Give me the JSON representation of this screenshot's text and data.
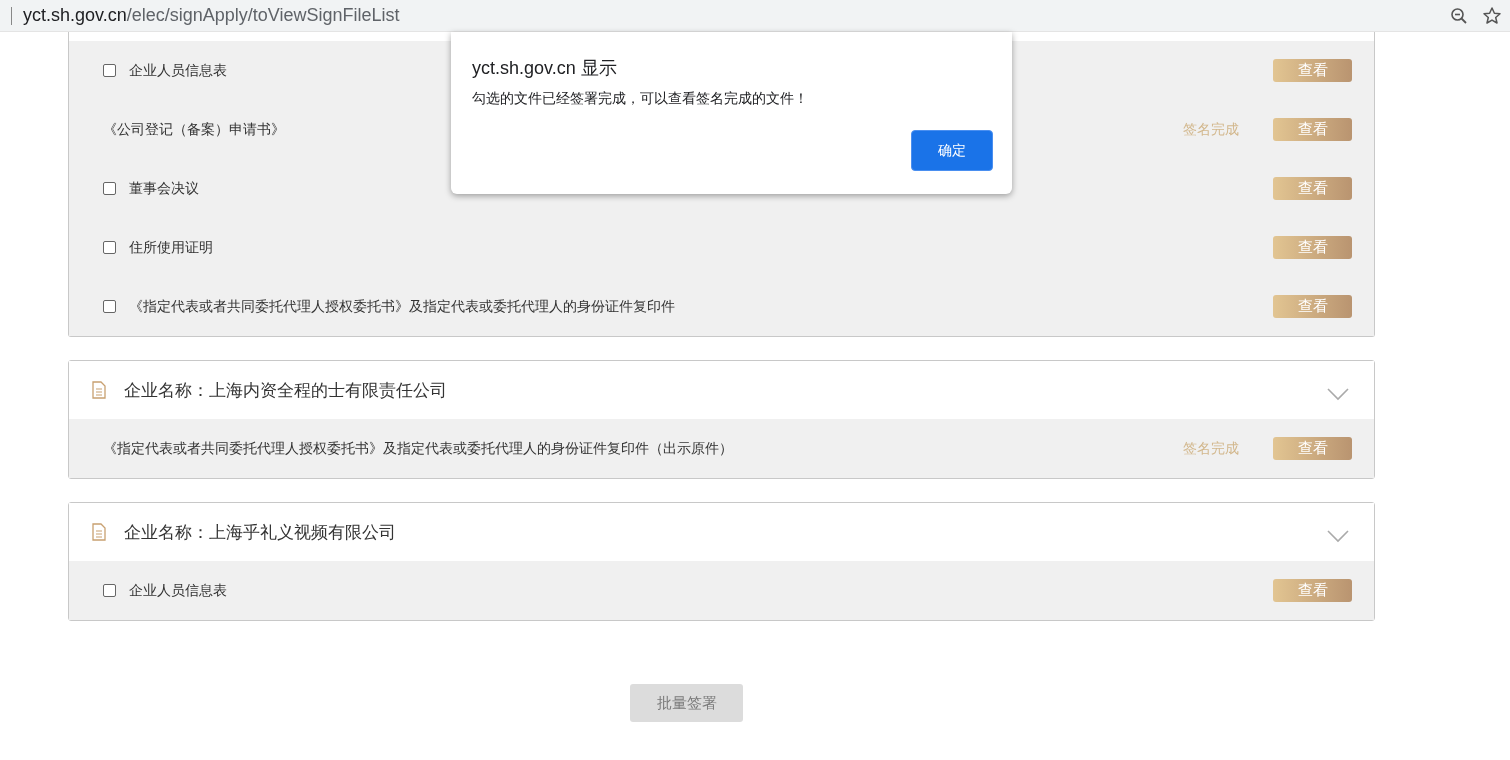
{
  "address_bar": {
    "url_host": "yct.sh.gov.cn",
    "url_path": "/elec/signApply/toViewSignFileList"
  },
  "groups": [
    {
      "rows": [
        {
          "kind": "checkbox",
          "checked": false,
          "name": "企业人员信息表",
          "action": "查看"
        },
        {
          "kind": "signed",
          "name": "《公司登记（备案）申请书》",
          "status": "签名完成",
          "action": "查看"
        },
        {
          "kind": "checkbox",
          "checked": false,
          "name": "董事会决议",
          "action": "查看"
        },
        {
          "kind": "checkbox",
          "checked": false,
          "name": "住所使用证明",
          "action": "查看"
        },
        {
          "kind": "checkbox",
          "checked": false,
          "name": "《指定代表或者共同委托代理人授权委托书》及指定代表或委托代理人的身份证件复印件",
          "action": "查看"
        }
      ]
    },
    {
      "company": "企业名称：上海内资全程的士有限责任公司",
      "expanded": true,
      "rows": [
        {
          "kind": "signed",
          "name": "《指定代表或者共同委托代理人授权委托书》及指定代表或委托代理人的身份证件复印件（出示原件）",
          "status": "签名完成",
          "action": "查看"
        }
      ]
    },
    {
      "company": "企业名称：上海乎礼义视频有限公司",
      "expanded": true,
      "rows": [
        {
          "kind": "checkbox",
          "checked": false,
          "name": "企业人员信息表",
          "action": "查看"
        }
      ]
    }
  ],
  "batch_button": {
    "label": "批量签署",
    "disabled": true
  },
  "dialog": {
    "title": "yct.sh.gov.cn 显示",
    "message": "勾选的文件已经签署完成，可以查看签名完成的文件！",
    "ok": "确定"
  }
}
